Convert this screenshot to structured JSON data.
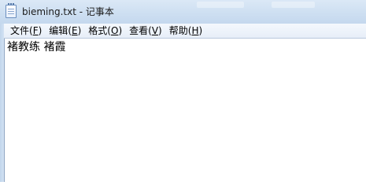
{
  "window": {
    "title": "bieming.txt - 记事本",
    "app_icon": "notepad-icon"
  },
  "menubar": {
    "items": [
      {
        "label": "文件",
        "hotkey": "F"
      },
      {
        "label": "编辑",
        "hotkey": "E"
      },
      {
        "label": "格式",
        "hotkey": "O"
      },
      {
        "label": "查看",
        "hotkey": "V"
      },
      {
        "label": "帮助",
        "hotkey": "H"
      }
    ]
  },
  "editor": {
    "content": "褚教练 褚霞"
  },
  "colors": {
    "titlebar": "#cfe0f2",
    "menubar": "#eef3fa",
    "editor_bg": "#ffffff"
  }
}
